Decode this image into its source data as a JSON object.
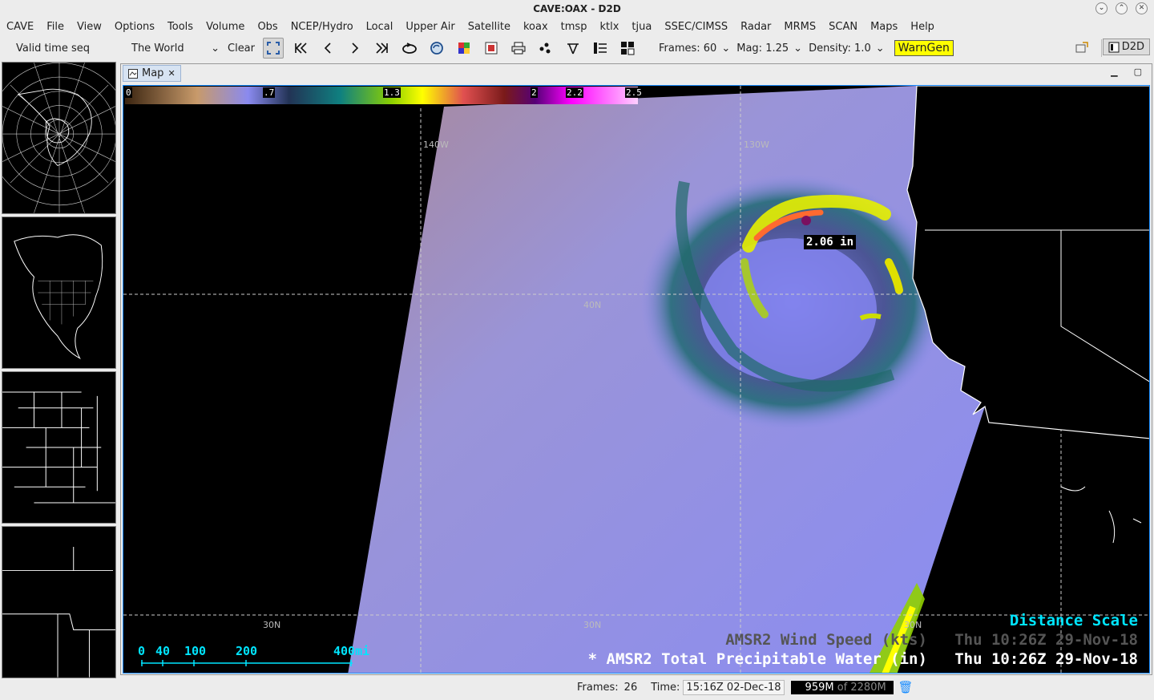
{
  "window": {
    "title": "CAVE:OAX - D2D",
    "controls": [
      "⌄",
      "⌃",
      "✕"
    ]
  },
  "menubar": [
    "CAVE",
    "File",
    "View",
    "Options",
    "Tools",
    "Volume",
    "Obs",
    "NCEP/Hydro",
    "Local",
    "Upper Air",
    "Satellite",
    "koax",
    "tmsp",
    "ktlx",
    "tjua",
    "SSEC/CIMSS",
    "Radar",
    "MRMS",
    "SCAN",
    "Maps",
    "Help"
  ],
  "toolbar": {
    "time_mode": "Valid time seq",
    "area": "The World",
    "clear": "Clear",
    "frames": "Frames: 60",
    "mag": "Mag: 1.25",
    "density": "Density: 1.0",
    "warngen": "WarnGen",
    "perspective": "D2D",
    "icons": [
      "zoom-fit-icon",
      "first-frame-icon",
      "prev-frame-icon",
      "next-frame-icon",
      "last-frame-icon",
      "loop-icon",
      "refresh-icon",
      "image-combine-icon",
      "colormap-icon",
      "print-icon",
      "points-icon",
      "baselines-icon",
      "panel-layout-icon",
      "panel-toggle-icon"
    ]
  },
  "tab": {
    "label": "Map"
  },
  "map": {
    "colorbar_labels": [
      "0",
      ".7",
      "1.3",
      "2",
      "2.2",
      "2.5"
    ],
    "grid_labels": {
      "lon": [
        "140W",
        "130W"
      ],
      "lat": [
        "40N",
        "30N",
        "30N",
        "30N"
      ]
    },
    "readout": "2.06 in",
    "distance_scale_title": "Distance Scale",
    "scale_ticks": [
      "0",
      "40",
      "100",
      "200",
      "400mi"
    ],
    "legend": [
      {
        "text": "AMSR2 Wind Speed (kts)   Thu 10:26Z 29-Nov-18",
        "color": "#555555"
      },
      {
        "text": "* AMSR2 Total Precipitable Water (in)   Thu 10:26Z 29-Nov-18",
        "color": "#ffffff"
      }
    ]
  },
  "statusbar": {
    "frames_label": "Frames:",
    "frames_value": "26",
    "time_label": "Time:",
    "time_value": "15:16Z 02-Dec-18",
    "mem_used": "959M",
    "mem_total": "of 2280M",
    "mem_fraction": 0.42
  }
}
